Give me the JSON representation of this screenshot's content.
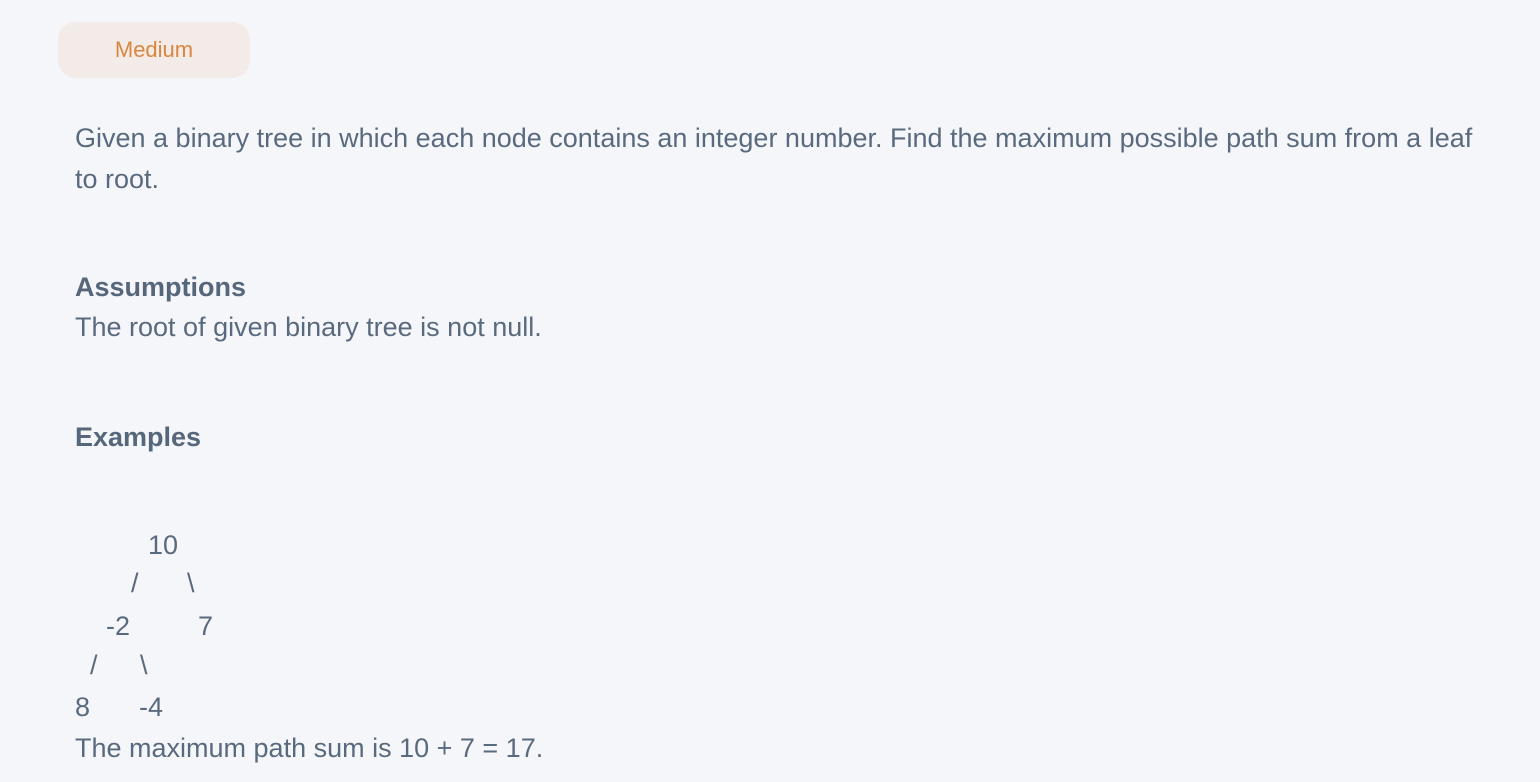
{
  "badge": {
    "label": "Medium"
  },
  "description": "Given a binary tree in which each node contains an integer number. Find the maximum possible path sum from a leaf to root.",
  "assumptions": {
    "heading": "Assumptions",
    "text": "The root of given binary tree is not null."
  },
  "examples": {
    "heading": "Examples",
    "tree": {
      "root": "10",
      "root_left_edge": "/",
      "root_right_edge": "\\",
      "left_child": "-2",
      "right_child": "7",
      "left_left_edge": "/",
      "left_right_edge": "\\",
      "left_left_leaf": "8",
      "left_right_leaf": "-4"
    },
    "result": "The maximum path sum is 10 + 7 = 17."
  }
}
